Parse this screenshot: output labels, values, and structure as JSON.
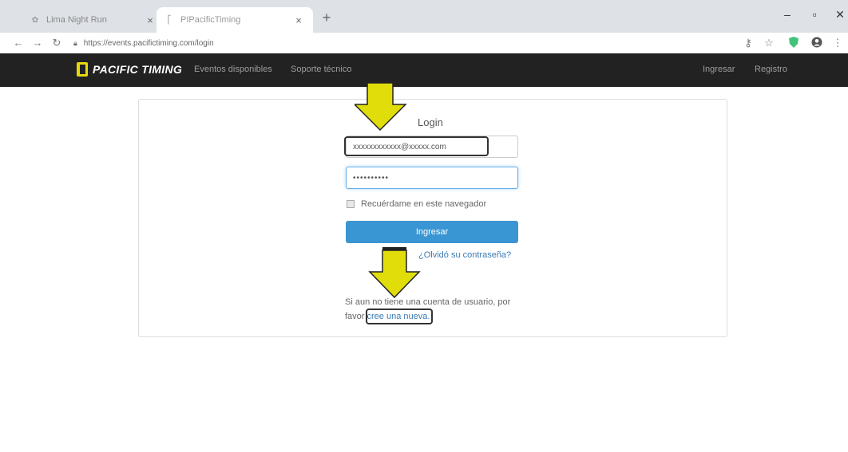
{
  "browser": {
    "tabs": [
      {
        "title": "Lima Night Run",
        "active": false
      },
      {
        "title": "PIPacificTiming",
        "active": true
      }
    ],
    "new_tab": "+",
    "url": "https://events.pacifictiming.com/login"
  },
  "site": {
    "brand": "PACIFIC TIMING",
    "nav_left": [
      "Eventos disponibles",
      "Soporte técnico"
    ],
    "nav_right": [
      "Ingresar",
      "Registro"
    ]
  },
  "login": {
    "title": "Login",
    "email_value": "xxxxxxxxxxxx@xxxxx.com",
    "password_value": "••••••••••",
    "remember_label": "Recuérdame en este navegador",
    "submit_label": "Ingresar",
    "forgot_label": "¿Olvidó su contraseña?",
    "signup_text": "Si aun no tiene una cuenta de usuario, por favor ",
    "signup_link": "cree una nueva."
  },
  "colors": {
    "navbar_bg": "#222222",
    "primary_button": "#3a95d3",
    "link": "#3a7bb6",
    "annotation_arrow": "#e0dd0b"
  },
  "icons": {
    "back": "arrow-left-icon",
    "forward": "arrow-right-icon",
    "reload": "reload-icon",
    "lock": "lock-icon",
    "key": "key-icon",
    "star": "star-icon",
    "shield": "shield-extension-icon",
    "account": "account-icon",
    "menu": "kebab-menu-icon"
  }
}
